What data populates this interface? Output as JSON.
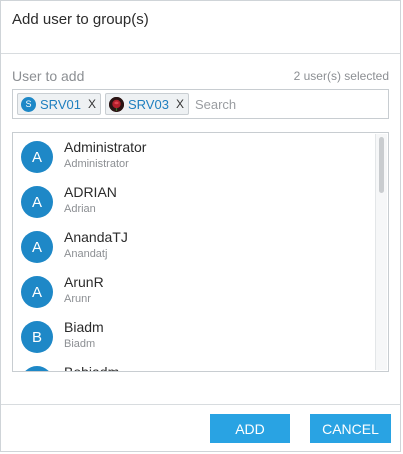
{
  "dialog": {
    "title": "Add user to group(s)",
    "field_label": "User to add",
    "selected_count": "2 user(s) selected",
    "search_placeholder": "Search",
    "chips": [
      {
        "avatar_text": "S",
        "label": "SRV01",
        "remove": "X",
        "avatar_style": "letter"
      },
      {
        "avatar_text": "",
        "label": "SRV03",
        "remove": "X",
        "avatar_style": "rose-image"
      }
    ],
    "users": [
      {
        "initial": "A",
        "name": "Administrator",
        "sub": "Administrator"
      },
      {
        "initial": "A",
        "name": "ADRIAN",
        "sub": "Adrian"
      },
      {
        "initial": "A",
        "name": "AnandaTJ",
        "sub": "Anandatj"
      },
      {
        "initial": "A",
        "name": "ArunR",
        "sub": "Arunr"
      },
      {
        "initial": "B",
        "name": "Biadm",
        "sub": "Biadm"
      },
      {
        "initial": "B",
        "name": "Bobiadm",
        "sub": ""
      }
    ],
    "buttons": {
      "add": "ADD",
      "cancel": "CANCEL"
    },
    "colors": {
      "accent": "#29a3e3",
      "avatar": "#1e88c7",
      "chip_text": "#1e7fbf"
    }
  }
}
